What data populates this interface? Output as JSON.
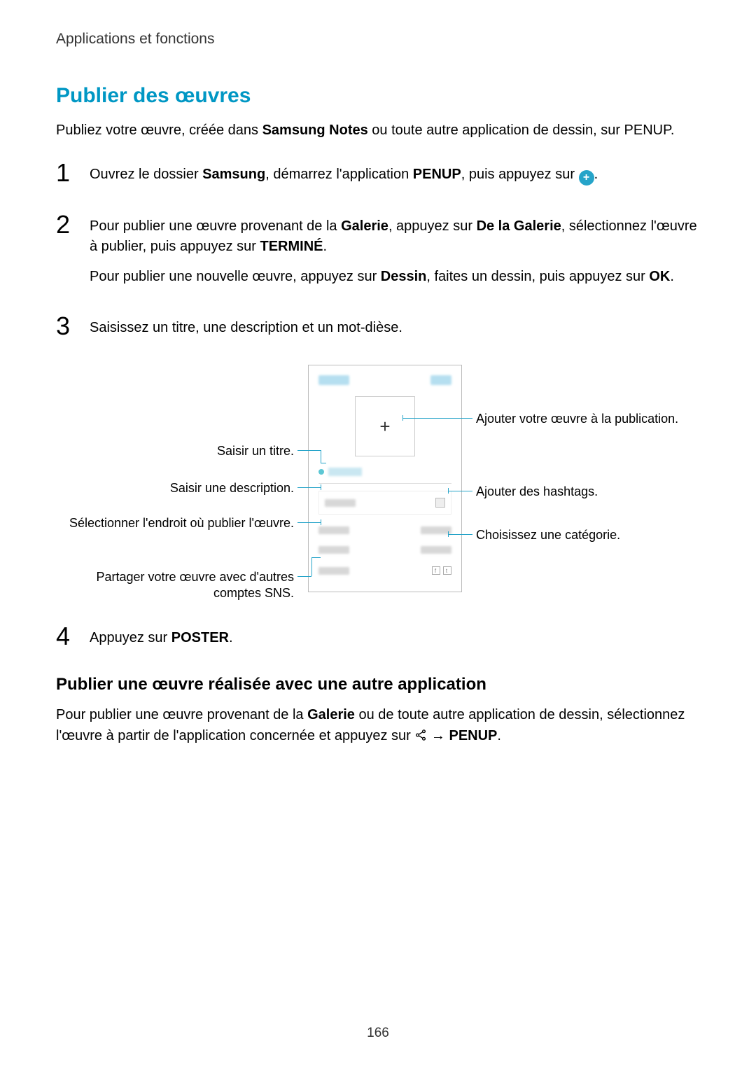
{
  "header": {
    "breadcrumb": "Applications et fonctions"
  },
  "title": "Publier des œuvres",
  "intro": {
    "pre": "Publiez votre œuvre, créée dans ",
    "bold1": "Samsung Notes",
    "post": " ou toute autre application de dessin, sur PENUP."
  },
  "steps": {
    "n1": "1",
    "s1": {
      "a": "Ouvrez le dossier ",
      "b": "Samsung",
      "c": ", démarrez l'application ",
      "d": "PENUP",
      "e": ", puis appuyez sur ",
      "f": "."
    },
    "n2": "2",
    "s2a": {
      "a": "Pour publier une œuvre provenant de la ",
      "b": "Galerie",
      "c": ", appuyez sur ",
      "d": "De la Galerie",
      "e": ", sélectionnez l'œuvre à publier, puis appuyez sur ",
      "f": "TERMINÉ",
      "g": "."
    },
    "s2b": {
      "a": "Pour publier une nouvelle œuvre, appuyez sur ",
      "b": "Dessin",
      "c": ", faites un dessin, puis appuyez sur ",
      "d": "OK",
      "e": "."
    },
    "n3": "3",
    "s3": "Saisissez un titre, une description et un mot-dièse.",
    "n4": "4",
    "s4": {
      "a": "Appuyez sur ",
      "b": "POSTER",
      "c": "."
    }
  },
  "callouts": {
    "add": "Ajouter votre œuvre à la publication.",
    "title": "Saisir un titre.",
    "desc": "Saisir une description.",
    "hash": "Ajouter des hashtags.",
    "where": "Sélectionner l'endroit où publier l'œuvre.",
    "cat": "Choisissez une catégorie.",
    "sns": "Partager votre œuvre avec d'autres comptes SNS."
  },
  "sub": {
    "heading": "Publier une œuvre réalisée avec une autre application",
    "p": {
      "a": "Pour publier une œuvre provenant de la ",
      "b": "Galerie",
      "c": " ou de toute autre application de dessin, sélectionnez l'œuvre à partir de l'application concernée et appuyez sur ",
      "arrow": " → ",
      "d": "PENUP",
      "e": "."
    }
  },
  "pageNumber": "166",
  "icons": {
    "plus": "+"
  }
}
